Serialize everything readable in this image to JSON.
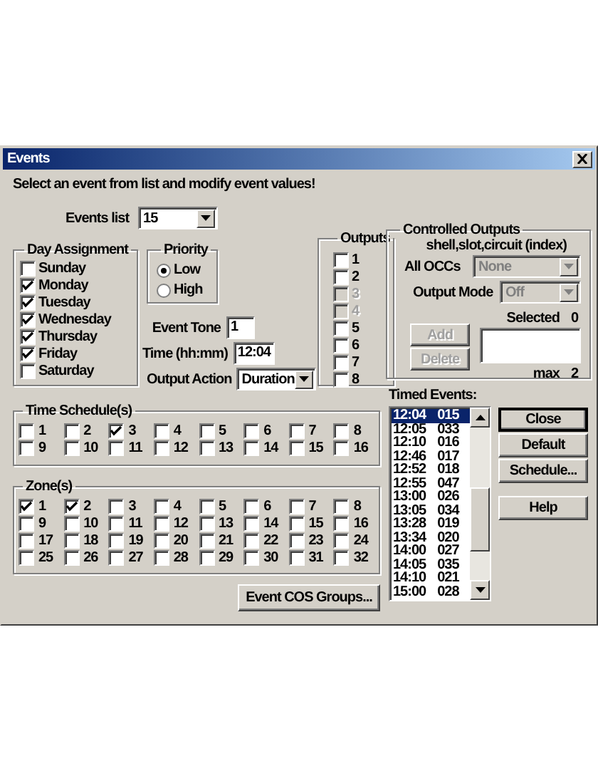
{
  "window": {
    "title": "Events"
  },
  "instruction": "Select an event from list and modify event values!",
  "events_list": {
    "label": "Events list",
    "value": "15"
  },
  "day_assignment": {
    "title": "Day Assignment",
    "days": [
      {
        "label": "Sunday",
        "checked": false
      },
      {
        "label": "Monday",
        "checked": true
      },
      {
        "label": "Tuesday",
        "checked": true
      },
      {
        "label": "Wednesday",
        "checked": true
      },
      {
        "label": "Thursday",
        "checked": true
      },
      {
        "label": "Friday",
        "checked": true
      },
      {
        "label": "Saturday",
        "checked": false
      }
    ]
  },
  "priority": {
    "title": "Priority",
    "options": [
      {
        "label": "Low",
        "selected": true
      },
      {
        "label": "High",
        "selected": false
      }
    ]
  },
  "event_tone": {
    "label": "Event Tone",
    "value": "1"
  },
  "time": {
    "label": "Time (hh:mm)",
    "value": "12:04"
  },
  "output_action": {
    "label": "Output Action",
    "value": "Duration"
  },
  "outputs": {
    "title": "Outputs",
    "items": [
      {
        "label": "1",
        "checked": false,
        "disabled": false
      },
      {
        "label": "2",
        "checked": false,
        "disabled": false
      },
      {
        "label": "3",
        "checked": false,
        "disabled": true
      },
      {
        "label": "4",
        "checked": false,
        "disabled": true
      },
      {
        "label": "5",
        "checked": false,
        "disabled": false
      },
      {
        "label": "6",
        "checked": false,
        "disabled": false
      },
      {
        "label": "7",
        "checked": false,
        "disabled": false
      },
      {
        "label": "8",
        "checked": false,
        "disabled": false
      }
    ]
  },
  "controlled_outputs": {
    "title": "Controlled Outputs",
    "subtitle": "shell,slot,circuit (index)",
    "all_occs": {
      "label": "All OCCs",
      "value": "None",
      "disabled": true
    },
    "output_mode": {
      "label": "Output Mode",
      "value": "Off",
      "disabled": true
    },
    "add_button": {
      "label": "Add",
      "disabled": true
    },
    "delete_button": {
      "label": "Delete",
      "disabled": true
    },
    "selected_label": "Selected",
    "selected_count": "0",
    "max_label": "max",
    "max_value": "2"
  },
  "time_schedules": {
    "title": "Time Schedule(s)",
    "items": [
      {
        "label": "1",
        "checked": false
      },
      {
        "label": "2",
        "checked": false
      },
      {
        "label": "3",
        "checked": true
      },
      {
        "label": "4",
        "checked": false
      },
      {
        "label": "5",
        "checked": false
      },
      {
        "label": "6",
        "checked": false
      },
      {
        "label": "7",
        "checked": false
      },
      {
        "label": "8",
        "checked": false
      },
      {
        "label": "9",
        "checked": false
      },
      {
        "label": "10",
        "checked": false
      },
      {
        "label": "11",
        "checked": false
      },
      {
        "label": "12",
        "checked": false
      },
      {
        "label": "13",
        "checked": false
      },
      {
        "label": "14",
        "checked": false
      },
      {
        "label": "15",
        "checked": false
      },
      {
        "label": "16",
        "checked": false
      }
    ]
  },
  "zones": {
    "title": "Zone(s)",
    "items": [
      {
        "label": "1",
        "checked": true
      },
      {
        "label": "2",
        "checked": true
      },
      {
        "label": "3",
        "checked": false
      },
      {
        "label": "4",
        "checked": false
      },
      {
        "label": "5",
        "checked": false
      },
      {
        "label": "6",
        "checked": false
      },
      {
        "label": "7",
        "checked": false
      },
      {
        "label": "8",
        "checked": false
      },
      {
        "label": "9",
        "checked": false
      },
      {
        "label": "10",
        "checked": false
      },
      {
        "label": "11",
        "checked": false
      },
      {
        "label": "12",
        "checked": false
      },
      {
        "label": "13",
        "checked": false
      },
      {
        "label": "14",
        "checked": false
      },
      {
        "label": "15",
        "checked": false
      },
      {
        "label": "16",
        "checked": false
      },
      {
        "label": "17",
        "checked": false
      },
      {
        "label": "18",
        "checked": false
      },
      {
        "label": "19",
        "checked": false
      },
      {
        "label": "20",
        "checked": false
      },
      {
        "label": "21",
        "checked": false
      },
      {
        "label": "22",
        "checked": false
      },
      {
        "label": "23",
        "checked": false
      },
      {
        "label": "24",
        "checked": false
      },
      {
        "label": "25",
        "checked": false
      },
      {
        "label": "26",
        "checked": false
      },
      {
        "label": "27",
        "checked": false
      },
      {
        "label": "28",
        "checked": false
      },
      {
        "label": "29",
        "checked": false
      },
      {
        "label": "30",
        "checked": false
      },
      {
        "label": "31",
        "checked": false
      },
      {
        "label": "32",
        "checked": false
      }
    ]
  },
  "cos_button": "Event COS Groups...",
  "timed_events": {
    "label": "Timed Events:",
    "rows": [
      {
        "time": "12:04",
        "event": "015",
        "selected": true
      },
      {
        "time": "12:05",
        "event": "033",
        "selected": false
      },
      {
        "time": "12:10",
        "event": "016",
        "selected": false
      },
      {
        "time": "12:46",
        "event": "017",
        "selected": false
      },
      {
        "time": "12:52",
        "event": "018",
        "selected": false
      },
      {
        "time": "12:55",
        "event": "047",
        "selected": false
      },
      {
        "time": "13:00",
        "event": "026",
        "selected": false
      },
      {
        "time": "13:05",
        "event": "034",
        "selected": false
      },
      {
        "time": "13:28",
        "event": "019",
        "selected": false
      },
      {
        "time": "13:34",
        "event": "020",
        "selected": false
      },
      {
        "time": "14:00",
        "event": "027",
        "selected": false
      },
      {
        "time": "14:05",
        "event": "035",
        "selected": false
      },
      {
        "time": "14:10",
        "event": "021",
        "selected": false
      },
      {
        "time": "15:00",
        "event": "028",
        "selected": false
      }
    ]
  },
  "buttons": [
    {
      "label": "Close",
      "default": true
    },
    {
      "label": "Default",
      "default": false
    },
    {
      "label": "Schedule...",
      "default": false
    },
    {
      "label": "Help",
      "default": false
    }
  ]
}
